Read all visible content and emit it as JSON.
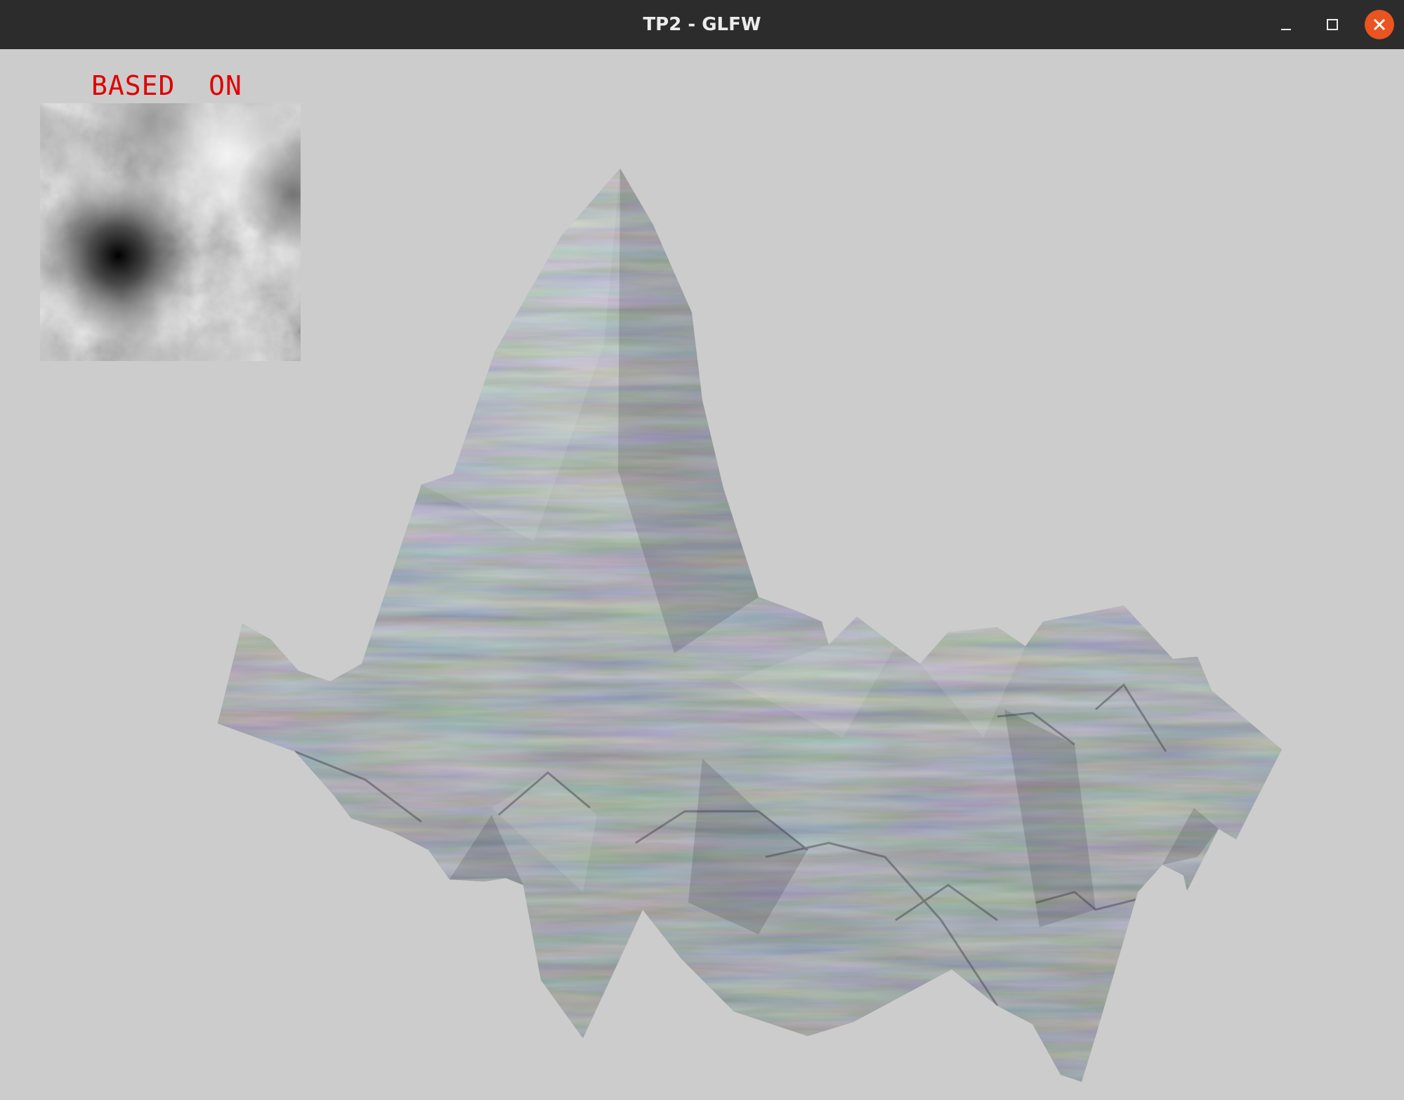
{
  "window": {
    "title": "TP2 - GLFW"
  },
  "window_controls": {
    "minimize_icon": "minimize-icon",
    "maximize_icon": "maximize-icon",
    "close_icon": "close-icon",
    "close_color": "#e95420"
  },
  "viewport": {
    "background_color": "#cccccc",
    "overlay_label": "BASED  ON",
    "overlay_label_color": "#e00000"
  }
}
